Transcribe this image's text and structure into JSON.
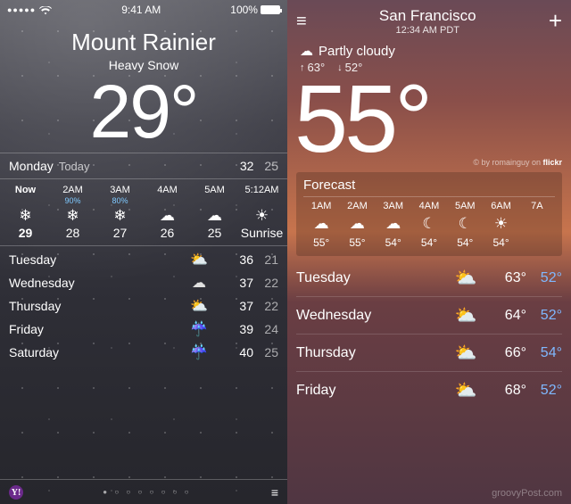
{
  "left": {
    "status_bar": {
      "signal_dots": "●●●●●",
      "time": "9:41 AM",
      "battery_pct": "100%"
    },
    "location": "Mount Rainier",
    "condition": "Heavy Snow",
    "temp": "29°",
    "today": {
      "day": "Monday",
      "label": "Today",
      "hi": "32",
      "lo": "25"
    },
    "hourly": [
      {
        "time": "Now",
        "pop": "",
        "icon": "❄︎",
        "temp": "29",
        "bold": true
      },
      {
        "time": "2AM",
        "pop": "90%",
        "icon": "❄︎",
        "temp": "28"
      },
      {
        "time": "3AM",
        "pop": "80%",
        "icon": "❄︎",
        "temp": "27"
      },
      {
        "time": "4AM",
        "pop": "",
        "icon": "☁︎",
        "temp": "26"
      },
      {
        "time": "5AM",
        "pop": "",
        "icon": "☁︎",
        "temp": "25"
      },
      {
        "time": "5:12AM",
        "pop": "",
        "icon": "☀︎",
        "temp": "Sunrise"
      }
    ],
    "daily": [
      {
        "day": "Tuesday",
        "icon": "⛅",
        "hi": "36",
        "lo": "21"
      },
      {
        "day": "Wednesday",
        "icon": "☁︎",
        "hi": "37",
        "lo": "22"
      },
      {
        "day": "Thursday",
        "icon": "⛅",
        "hi": "37",
        "lo": "22"
      },
      {
        "day": "Friday",
        "icon": "☔",
        "hi": "39",
        "lo": "24"
      },
      {
        "day": "Saturday",
        "icon": "☔",
        "hi": "40",
        "lo": "25"
      }
    ],
    "footer": {
      "provider": "Y!",
      "pager": "● ○ ○ ○ ○ ○ ○ ○",
      "list_icon": "≡"
    }
  },
  "right": {
    "city": "San Francisco",
    "time": "12:34 AM PDT",
    "condition_icon": "☁︎",
    "condition": "Partly cloudy",
    "hi_arrow": "↑",
    "hi": "63°",
    "lo_arrow": "↓",
    "lo": "52°",
    "temp": "55°",
    "attribution_pre": "© by romainguy on ",
    "attribution_brand": "flickr",
    "forecast_label": "Forecast",
    "hourly": [
      {
        "time": "1AM",
        "icon": "☁︎",
        "temp": "55°"
      },
      {
        "time": "2AM",
        "icon": "☁︎",
        "temp": "55°"
      },
      {
        "time": "3AM",
        "icon": "☁︎",
        "temp": "54°"
      },
      {
        "time": "4AM",
        "icon": "☾",
        "temp": "54°"
      },
      {
        "time": "5AM",
        "icon": "☾",
        "temp": "54°"
      },
      {
        "time": "6AM",
        "icon": "☀︎",
        "temp": "54°"
      },
      {
        "time": "7A",
        "icon": "",
        "temp": ""
      }
    ],
    "daily": [
      {
        "day": "Tuesday",
        "icon": "⛅",
        "hi": "63°",
        "lo": "52°"
      },
      {
        "day": "Wednesday",
        "icon": "⛅",
        "hi": "64°",
        "lo": "52°"
      },
      {
        "day": "Thursday",
        "icon": "⛅",
        "hi": "66°",
        "lo": "54°"
      },
      {
        "day": "Friday",
        "icon": "⛅",
        "hi": "68°",
        "lo": "52°"
      }
    ],
    "watermark": "groovyPost.com"
  }
}
